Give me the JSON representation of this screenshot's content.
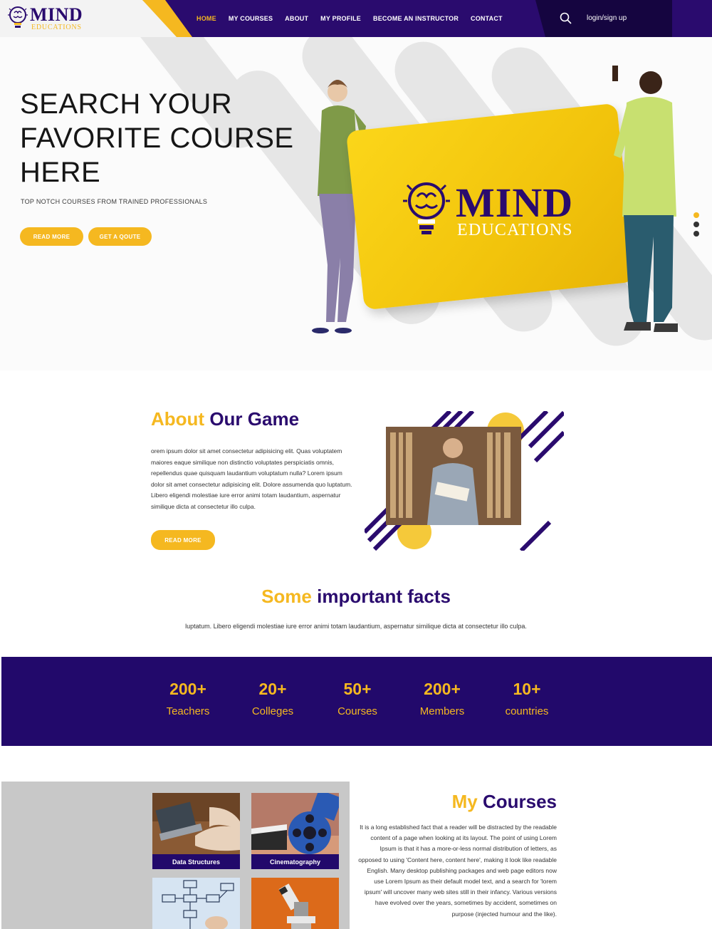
{
  "brand": {
    "name": "MIND",
    "tagline": "EDUCATIONS"
  },
  "nav": {
    "items": [
      {
        "label": "HOME",
        "active": true
      },
      {
        "label": "MY COURSES"
      },
      {
        "label": "ABOUT"
      },
      {
        "label": "MY PROFILE"
      },
      {
        "label": "BECOME AN INSTRUCTOR"
      },
      {
        "label": "CONTACT"
      }
    ],
    "search_icon": "search-icon",
    "login_label": "login/sign up"
  },
  "hero": {
    "title_lines": [
      "SEARCH YOUR",
      "FAVORITE COURSE",
      "HERE"
    ],
    "subtitle": "TOP NOTCH COURSES FROM TRAINED PROFESSIONALS",
    "read_more": "READ MORE",
    "get_quote": "GET A QOUTE",
    "card_brand": "MIND",
    "card_tagline": "EDUCATIONS"
  },
  "about": {
    "title_accent": "About",
    "title_rest": "Our Game",
    "text": "orem ipsum dolor sit amet consectetur adipisicing elit. Quas voluptatem maiores eaque similique non distinctio voluptates perspiciatis omnis, repellendus quae quisquam laudantium voluptatum nulla? Lorem ipsum dolor sit amet consectetur adipisicing elit. Dolore assumenda quo luptatum. Libero eligendi molestiae iure error animi totam laudantium, aspernatur similique dicta at consectetur illo culpa.",
    "read_more": "READ MORE"
  },
  "facts": {
    "title_accent": "Some",
    "title_rest": "important facts",
    "subtitle": "luptatum. Libero eligendi molestiae iure error animi totam laudantium, aspernatur similique dicta at consectetur illo culpa.",
    "stats": [
      {
        "value": "200+",
        "label": "Teachers"
      },
      {
        "value": "20+",
        "label": "Colleges"
      },
      {
        "value": "50+",
        "label": "Courses"
      },
      {
        "value": "200+",
        "label": "Members"
      },
      {
        "value": "10+",
        "label": "countries"
      }
    ]
  },
  "courses": {
    "title_accent": "My",
    "title_rest": "Courses",
    "text": "It is a long established fact that a reader will be distracted by the readable content of a page when looking at its layout. The point of using Lorem Ipsum is that it has a more-or-less normal distribution of letters, as opposed to using 'Content here, content here', making it look like readable English. Many desktop publishing packages and web page editors now use Lorem Ipsum as their default model text, and a search for 'lorem ipsum' will uncover many web sites still in their infancy. Various versions have evolved over the years, sometimes by accident, sometimes on purpose (injected humour and the like).",
    "cards": [
      {
        "label": "Data Structures"
      },
      {
        "label": "Cinematography"
      },
      {
        "label": ""
      },
      {
        "label": ""
      }
    ]
  },
  "colors": {
    "primary": "#22096b",
    "accent": "#f5b820"
  }
}
